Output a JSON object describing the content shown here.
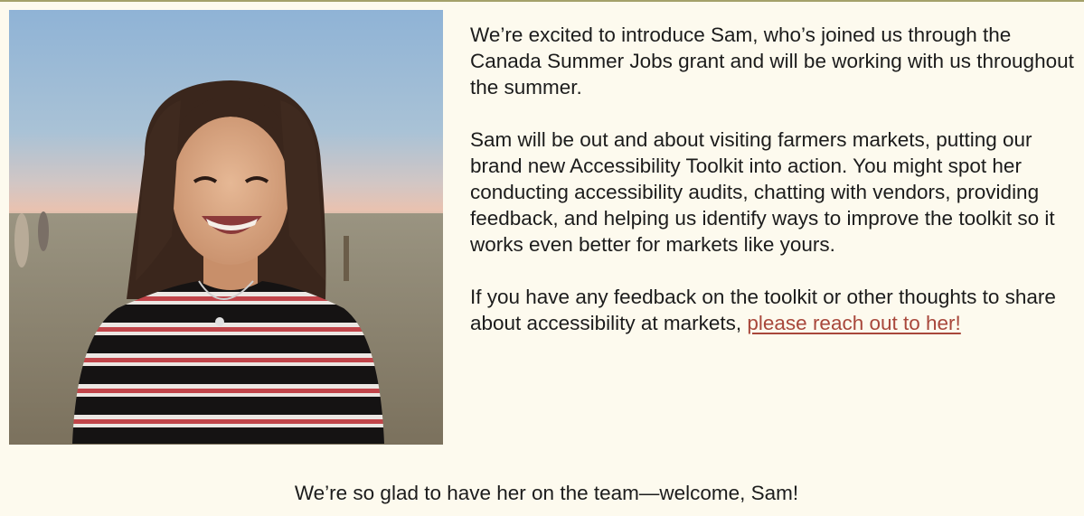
{
  "photo": {
    "icon": "portrait-photo"
  },
  "intro": {
    "paragraph1": "We’re excited to introduce Sam, who’s joined us through the Canada Summer Jobs grant and will be working with us throughout the summer.",
    "paragraph2": "Sam will be out and about visiting farmers markets, putting our brand new Accessibility Toolkit into action. You might spot her conducting accessibility audits, chatting with vendors, providing feedback, and helping us identify ways to improve the toolkit so it works even better for markets like yours.",
    "paragraph3_text": "If you have any feedback on the toolkit or other thoughts to share about accessibility at markets,",
    "contact_link": "please reach out to her!"
  },
  "closing": {
    "text": "We’re so glad to have her on the team—welcome, Sam!"
  },
  "colors": {
    "background": "#fdfaee",
    "link": "#a8473b",
    "rule": "#a4a16a"
  }
}
